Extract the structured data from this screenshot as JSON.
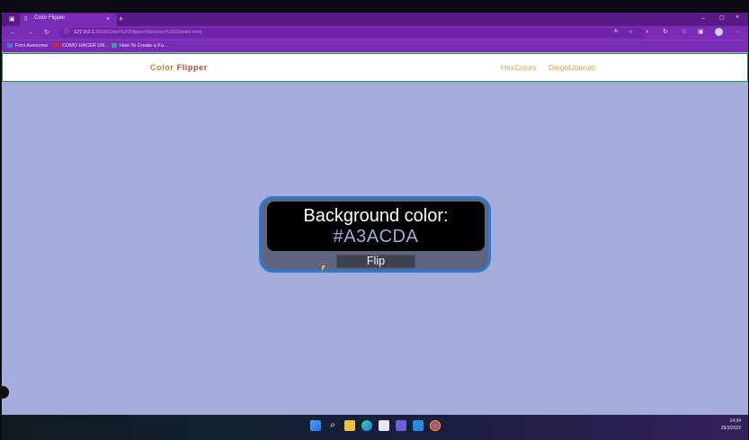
{
  "browser": {
    "tab_title": "Color Flipper",
    "new_tab": "+",
    "tab_close": "×",
    "window_controls": {
      "minimize": "–",
      "maximize": "▢",
      "close": "×"
    },
    "url_host": "127.0.0.1",
    "url_rest": ":5500/Color%20Flipper/Solucion%202/index.html",
    "bookmarks": [
      {
        "label": "Font Awesome",
        "color": "#3a7bd5"
      },
      {
        "label": "COMO HACER UN...",
        "color": "#e02020"
      },
      {
        "label": "How To Create a Fu...",
        "color": "#2fa4a4"
      }
    ]
  },
  "page": {
    "brand_part1": "Color ",
    "brand_part2": "Flipper",
    "nav": [
      "HexColors",
      "DiegoLibonati"
    ],
    "background_label": "Background color:",
    "background_value": "#A3ACDA",
    "flip_button": "Flip",
    "colors": {
      "background": "#A3ACDA",
      "brand": "#c8832a",
      "card_border": "#2a7ad0"
    }
  },
  "taskbar": {
    "icons": [
      "windows-icon",
      "search-icon",
      "file-explorer-icon",
      "edge-icon",
      "store-icon",
      "teams-icon",
      "vscode-icon",
      "chrome-icon"
    ],
    "time": "14:34",
    "date": "29/3/2022"
  }
}
